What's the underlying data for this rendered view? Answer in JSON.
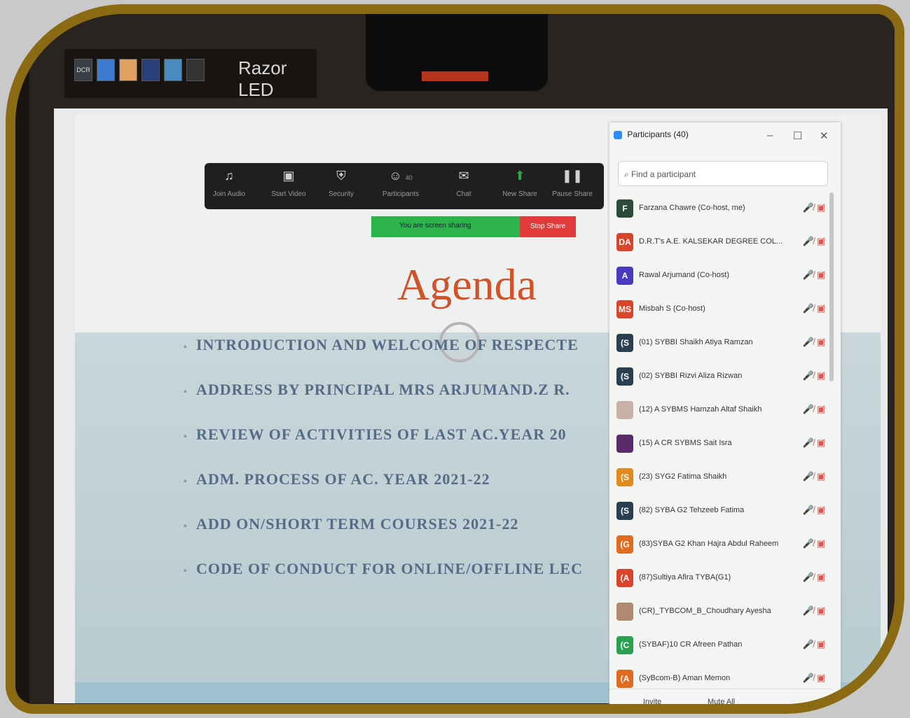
{
  "taskbar": {
    "icons": [
      "DCR",
      "",
      "",
      "",
      "",
      ""
    ],
    "app_label": "Razor LED"
  },
  "toolbar": {
    "join_audio": "Join Audio",
    "start_video": "Start Video",
    "security": "Security",
    "participants": "Participants",
    "participants_count": "40",
    "chat": "Chat",
    "new_share": "New Share",
    "pause_share": "Pause Share"
  },
  "sharebar": {
    "status": "You are screen sharing",
    "stop": "Stop Share"
  },
  "slide": {
    "title": "Agenda",
    "bullets": [
      "INTRODUCTION AND WELCOME OF RESPECTE",
      "ADDRESS BY PRINCIPAL MRS ARJUMAND.Z R.",
      "REVIEW OF ACTIVITIES OF  LAST AC.YEAR 20",
      "ADM. PROCESS OF AC. YEAR 2021-22",
      "ADD ON/SHORT TERM COURSES 2021-22",
      "CODE OF CONDUCT FOR ONLINE/OFFLINE LEC"
    ]
  },
  "panel": {
    "title": "Participants (40)",
    "search_placeholder": "Find a participant",
    "participants": [
      {
        "initials": "F",
        "color": "#2a4a3a",
        "name": "Farzana Chawre (Co-host, me)"
      },
      {
        "initials": "DA",
        "color": "#d9442a",
        "name": "D.R.T's A.E. KALSEKAR DEGREE COL... (Host)"
      },
      {
        "initials": "A",
        "color": "#4b3ac0",
        "name": "Rawal Arjumand (Co-host)"
      },
      {
        "initials": "MS",
        "color": "#d9442a",
        "name": "Misbah S (Co-host)"
      },
      {
        "initials": "(S",
        "color": "#2a4050",
        "name": "(01) SYBBI Shaikh Atiya Ramzan"
      },
      {
        "initials": "(S",
        "color": "#2a4050",
        "name": "(02) SYBBI Rizvi Aliza Rizwan"
      },
      {
        "initials": "",
        "color": "#c8b0a8",
        "name": "(12) A SYBMS Hamzah Altaf Shaikh"
      },
      {
        "initials": "",
        "color": "#5a2a6a",
        "name": "(15) A CR SYBMS Sait Isra"
      },
      {
        "initials": "(S",
        "color": "#e08a20",
        "name": "(23)  SYG2  Fatima Shaikh"
      },
      {
        "initials": "(S",
        "color": "#2a4050",
        "name": "(82) SYBA G2 Tehzeeb Fatima"
      },
      {
        "initials": "(G",
        "color": "#e06a20",
        "name": "(83)SYBA G2 Khan Hajra Abdul Raheem"
      },
      {
        "initials": "(A",
        "color": "#d9442a",
        "name": "(87)Sultiya Afira TYBA(G1)"
      },
      {
        "initials": "",
        "color": "#b08a70",
        "name": "(CR)_TYBCOM_B_Choudhary Ayesha"
      },
      {
        "initials": "(C",
        "color": "#2aa050",
        "name": "(SYBAF)10 CR Afreen Pathan"
      },
      {
        "initials": "(A",
        "color": "#e06a20",
        "name": "(SyBcom-B) Aman Memon"
      }
    ],
    "invite": "Invite",
    "mute_all": "Mute All"
  }
}
